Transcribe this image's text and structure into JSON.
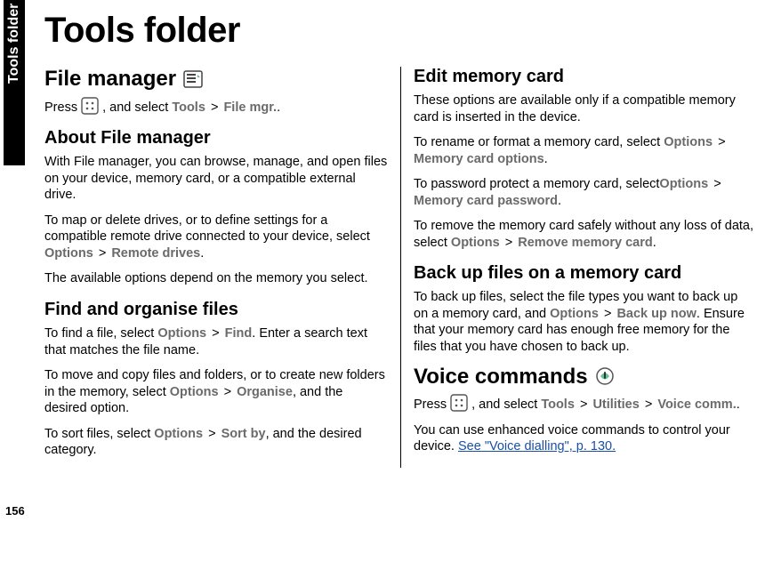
{
  "side_tab": "Tools folder",
  "page_number": "156",
  "title": "Tools folder",
  "left": {
    "file_manager_heading": "File manager",
    "fm_press_1": "Press ",
    "fm_press_2": " , and select ",
    "fm_tools": "Tools",
    "fm_gt": ">",
    "fm_filemgr": "File mgr.",
    "fm_period": ".",
    "about_heading": "About File manager",
    "about_p1": "With File manager, you can browse, manage, and open files on your device, memory card, or a compatible external drive.",
    "about_p2a": "To map or delete drives, or to define settings for a compatible remote drive connected to your device, select ",
    "about_options": "Options",
    "about_gt": ">",
    "about_remote": "Remote drives",
    "about_p2b": ".",
    "about_p3": "The available options depend on the memory you select.",
    "find_heading": "Find and organise files",
    "find_p1a": "To find a file, select ",
    "find_options1": "Options",
    "find_gt1": ">",
    "find_find": "Find",
    "find_p1b": ". Enter a search text that matches the file name.",
    "find_p2a": "To move and copy files and folders, or to create new folders in the memory, select ",
    "find_options2": "Options",
    "find_gt2": ">",
    "find_organise": "Organise",
    "find_p2b": ", and the desired option.",
    "find_p3a": "To sort files, select ",
    "find_options3": "Options",
    "find_gt3": ">",
    "find_sortby": "Sort by",
    "find_p3b": ", and the desired category."
  },
  "right": {
    "edit_heading": "Edit memory card",
    "edit_p1": "These options are available only if a compatible memory card is inserted in the device.",
    "edit_p2a": "To rename or format a memory card, select ",
    "edit_options1": "Options",
    "edit_gt1": ">",
    "edit_mco": "Memory card options",
    "edit_p2b": ".",
    "edit_p3a": "To password protect a memory card, select",
    "edit_options2": "Options",
    "edit_gt2": ">",
    "edit_mcp": "Memory card password",
    "edit_p3b": ".",
    "edit_p4a": "To remove the memory card safely without any loss of data, select ",
    "edit_options3": "Options",
    "edit_gt3": ">",
    "edit_rmc": "Remove memory card",
    "edit_p4b": ".",
    "backup_heading": "Back up files on a memory card",
    "backup_p1a": "To back up files, select the file types you want to back up on a memory card, and ",
    "backup_options": "Options",
    "backup_gt": ">",
    "backup_now": "Back up now",
    "backup_p1b": ". Ensure that your memory card has enough free memory for the files that you have chosen to back up.",
    "voice_heading": "Voice commands",
    "voice_p1a": "Press ",
    "voice_p1b": " , and select ",
    "voice_tools": "Tools",
    "voice_gt1": ">",
    "voice_utilities": "Utilities",
    "voice_gt2": ">",
    "voice_comm": "Voice comm.",
    "voice_p1c": ".",
    "voice_p2a": "You can use enhanced voice commands to control your device. ",
    "voice_link": "See \"Voice dialling\", p. 130."
  }
}
